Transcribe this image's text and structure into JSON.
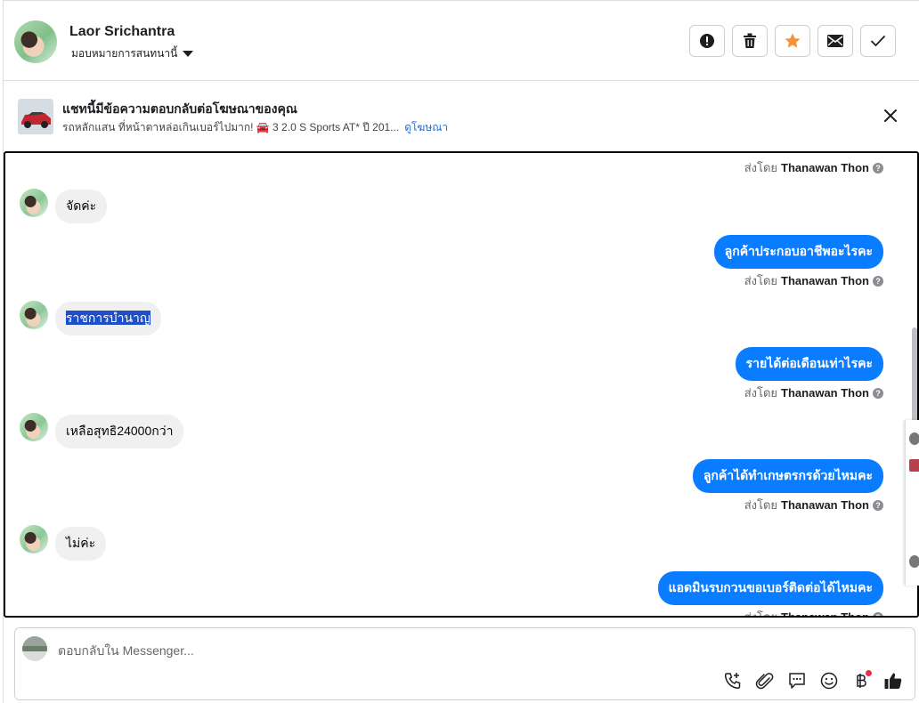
{
  "header": {
    "user_name": "Laor Srichantra",
    "assign_label": "มอบหมายการสนทนานี้",
    "actions": [
      {
        "name": "report-button",
        "icon": "exclamation-icon"
      },
      {
        "name": "delete-button",
        "icon": "trash-icon"
      },
      {
        "name": "star-button",
        "icon": "star-icon"
      },
      {
        "name": "mark-unread-button",
        "icon": "envelope-icon"
      },
      {
        "name": "mark-done-button",
        "icon": "checkmark-icon"
      }
    ]
  },
  "ad_banner": {
    "title": "แชทนี้มีข้อความตอบกลับต่อโฆษณาของคุณ",
    "subtitle": "รถหลักแสน ที่หน้าตาหล่อเกินเบอร์ไปมาก! 🚘 3 2.0 S Sports AT* ปี 201...",
    "link": "ดูโฆษณา"
  },
  "messages": [
    {
      "dir": "meta",
      "prefix": "ส่งโดย",
      "sender": "Thanawan Thon"
    },
    {
      "dir": "in",
      "text": "จัดค่ะ"
    },
    {
      "dir": "out",
      "text": "ลูกค้าประกอบอาชีพอะไรคะ"
    },
    {
      "dir": "meta",
      "prefix": "ส่งโดย",
      "sender": "Thanawan Thon"
    },
    {
      "dir": "in",
      "text": "ราชการบำนาญ",
      "selected": true
    },
    {
      "dir": "out",
      "text": "รายได้ต่อเดือนเท่าไรคะ"
    },
    {
      "dir": "meta",
      "prefix": "ส่งโดย",
      "sender": "Thanawan Thon"
    },
    {
      "dir": "in",
      "text": "เหลือสุทธิ24000กว่า"
    },
    {
      "dir": "out",
      "text": "ลูกค้าได้ทำเกษตรกรด้วยไหมคะ"
    },
    {
      "dir": "meta",
      "prefix": "ส่งโดย",
      "sender": "Thanawan Thon"
    },
    {
      "dir": "in",
      "text": "ไม่ค่ะ"
    },
    {
      "dir": "out",
      "text": "แอดมินรบกวนขอเบอร์ติดต่อได้ไหมคะ"
    },
    {
      "dir": "meta",
      "prefix": "ส่งโดย",
      "sender": "Thanawan Thon"
    }
  ],
  "composer": {
    "placeholder": "ตอบกลับใน Messenger...",
    "tools": [
      "phone-add-icon",
      "paperclip-icon",
      "saved-reply-icon",
      "emoji-icon",
      "baht-icon",
      "thumbs-up-icon"
    ]
  },
  "colors": {
    "outgoing_bubble": "#0a7cff",
    "incoming_bubble": "#f0f0f0",
    "star": "#f7923b",
    "link": "#216fdb"
  }
}
